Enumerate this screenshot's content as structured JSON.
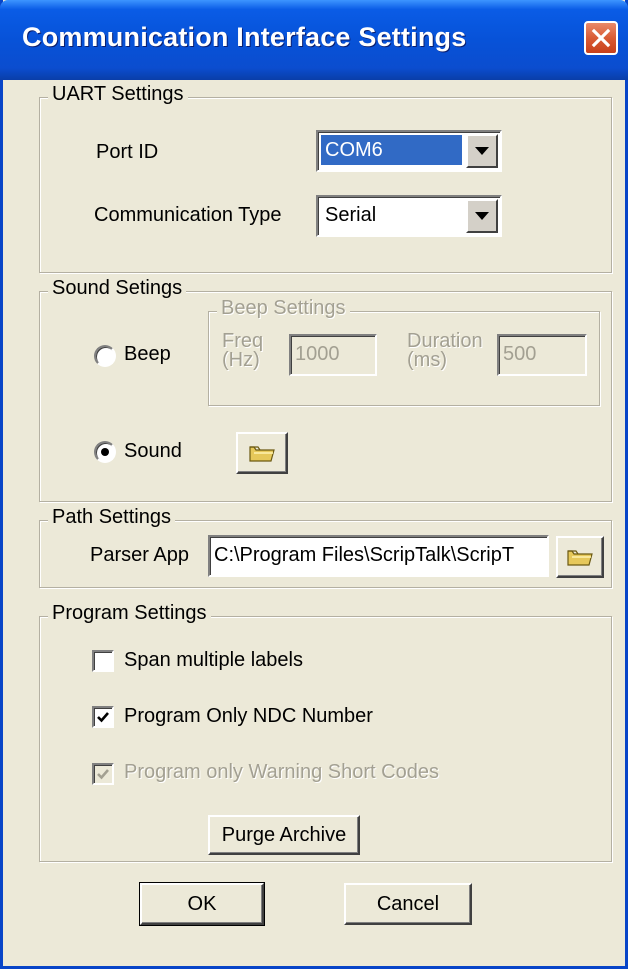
{
  "window": {
    "title": "Communication Interface Settings"
  },
  "uart": {
    "group_label": "UART Settings",
    "port_label": "Port ID",
    "port_value": "COM6",
    "comm_type_label": "Communication Type",
    "comm_type_value": "Serial"
  },
  "sound": {
    "group_label": "Sound Setings",
    "beep_label": "Beep",
    "beep_selected": false,
    "sound_label": "Sound",
    "sound_selected": true,
    "beep_settings": {
      "group_label": "Beep Settings",
      "freq_label": "Freq (Hz)",
      "freq_value": "1000",
      "duration_label": "Duration (ms)",
      "duration_value": "500"
    }
  },
  "path": {
    "group_label": "Path Settings",
    "parser_label": "Parser App",
    "parser_value": "C:\\Program Files\\ScripTalk\\ScripT"
  },
  "program": {
    "group_label": "Program Settings",
    "span_label": "Span multiple labels",
    "span_checked": false,
    "ndc_label": "Program Only NDC Number",
    "ndc_checked": true,
    "warning_label": "Program only Warning Short Codes",
    "warning_checked": true,
    "warning_disabled": true,
    "purge_label": "Purge Archive"
  },
  "buttons": {
    "ok": "OK",
    "cancel": "Cancel"
  },
  "icons": {
    "close": "close-icon",
    "folder": "folder-icon",
    "dropdown": "chevron-down-icon",
    "check": "checkmark-icon"
  },
  "colors": {
    "title_bar": "#0752d8",
    "selection": "#316ac5",
    "dialog_bg": "#ece9d8",
    "close_button": "#d95b35"
  }
}
